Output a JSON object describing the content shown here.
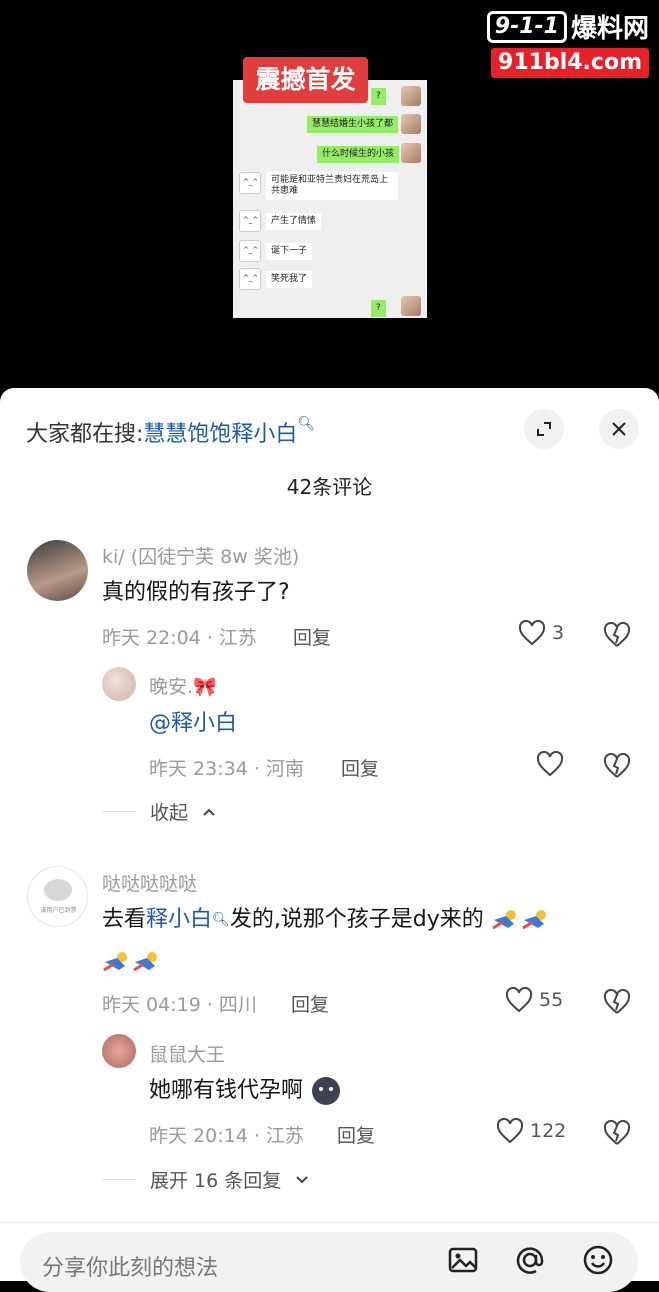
{
  "video": {
    "badge": "震撼首发",
    "watermark_num": "9-1-1",
    "watermark_cn": "爆料网",
    "watermark_url": "911bl4.com",
    "chat": [
      {
        "side": "right",
        "text": "?"
      },
      {
        "side": "right",
        "text": "慧慧结婚生小孩了都"
      },
      {
        "side": "right",
        "text": "什么时候生的小孩"
      },
      {
        "side": "left",
        "text": "可能是和亚特兰贵妇在荒岛上共患难"
      },
      {
        "side": "left",
        "text": "产生了情愫"
      },
      {
        "side": "left",
        "text": "诞下一子"
      },
      {
        "side": "left",
        "text": "笑死我了"
      },
      {
        "side": "right",
        "text": "?"
      }
    ]
  },
  "sheet": {
    "search_prefix": "大家都在搜:",
    "search_keyword": "慧慧饱饱释小白",
    "comment_count": "42条评论"
  },
  "comments": [
    {
      "user": "ki/ (囚徒宁芙 8w 奖池)",
      "text": "真的假的有孩子了?",
      "meta": "昨天 22:04 · 江苏",
      "reply": "回复",
      "likes": "3"
    },
    {
      "user": "晚安.🎀",
      "text": "@释小白",
      "meta": "昨天 23:34 · 河南",
      "reply": "回复",
      "likes": ""
    },
    {
      "fold": "收起"
    },
    {
      "user": "哒哒哒哒哒",
      "text_pre": "去看",
      "text_link": "释小白",
      "text_post": "发的,说那个孩子是dy来的",
      "meta": "昨天 04:19 · 四川",
      "reply": "回复",
      "likes": "55",
      "avatar_caption": "该用户已封禁"
    },
    {
      "user": "鼠鼠大王",
      "text": "她哪有钱代孕啊",
      "meta": "昨天 20:14 · 江苏",
      "reply": "回复",
      "likes": "122"
    },
    {
      "fold": "展开 16 条回复"
    }
  ],
  "composer": {
    "placeholder": "分享你此刻的想法"
  },
  "icons": [
    "expand-icon",
    "close-icon",
    "heart-icon",
    "broken-heart-icon",
    "chevron-up-icon",
    "chevron-down-icon",
    "image-icon",
    "at-icon",
    "emoji-icon"
  ],
  "colors": {
    "link": "#1e5aa8",
    "badge": "#e23d3d",
    "chat_green": "#95ec69"
  }
}
